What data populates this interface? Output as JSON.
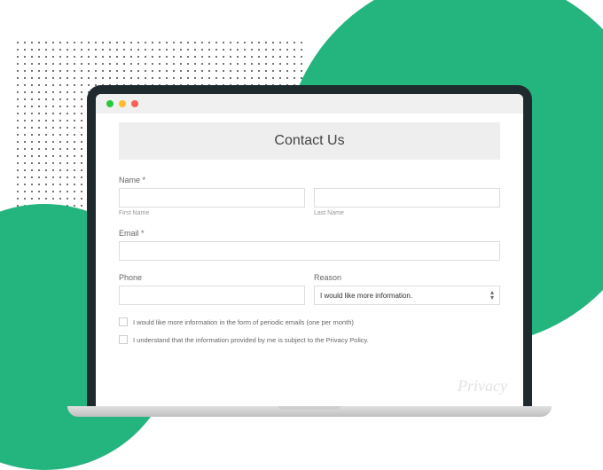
{
  "form": {
    "title": "Contact Us",
    "name_label": "Name *",
    "first_name_sublabel": "First Name",
    "last_name_sublabel": "Last Name",
    "email_label": "Email *",
    "phone_label": "Phone",
    "reason_label": "Reason",
    "reason_selected": "I would like more information.",
    "checkbox1": "I would like more information in the form of periodic emails (one per month)",
    "checkbox2": "I understand that the information provided by me is subject to the Privacy Policy."
  },
  "watermark": "Privacy"
}
